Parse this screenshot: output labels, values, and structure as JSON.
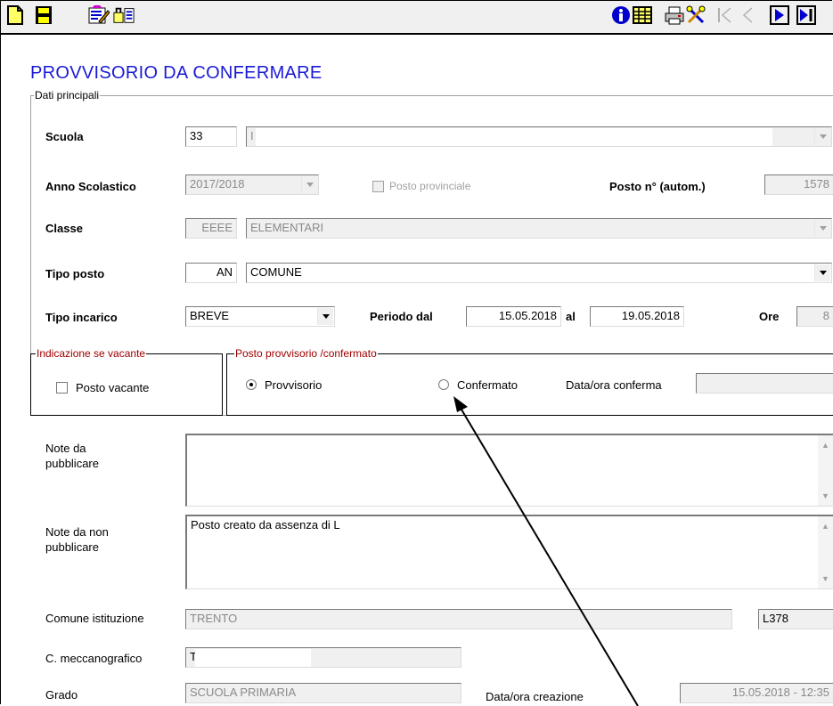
{
  "toolbar": {
    "icons": [
      "new-document-icon",
      "save-disk-icon",
      "edit-form-icon",
      "transfer-icon",
      "info-icon",
      "table-grid-icon",
      "print-icon",
      "tools-icon",
      "first-record-icon",
      "previous-record-icon",
      "next-record-icon",
      "last-record-icon"
    ]
  },
  "page_title": "PROVVISORIO DA CONFERMARE",
  "groups": {
    "dati_principali": "Dati principali",
    "vacante": "Indicazione se vacante",
    "provvisorio": "Posto provvisorio /confermato"
  },
  "fields": {
    "scuola": {
      "label": "Scuola",
      "code": "33",
      "name": "I"
    },
    "anno": {
      "label": "Anno Scolastico",
      "value": "2017/2018"
    },
    "posto_provinciale": {
      "label": "Posto provinciale",
      "checked": false
    },
    "posto_n": {
      "label": "Posto n° (autom.)",
      "value": "1578"
    },
    "classe": {
      "label": "Classe",
      "code": "EEEE",
      "name": "ELEMENTARI"
    },
    "tipo_posto": {
      "label": "Tipo posto",
      "code": "AN",
      "name": "COMUNE"
    },
    "tipo_incarico": {
      "label": "Tipo incarico",
      "value": "BREVE"
    },
    "periodo": {
      "label_dal": "Periodo dal",
      "dal": "15.05.2018",
      "label_al": "al",
      "al": "19.05.2018"
    },
    "ore": {
      "label": "Ore",
      "value": "8"
    },
    "posto_vacante": {
      "label": "Posto vacante",
      "checked": false
    },
    "radio_provvisorio": {
      "label": "Provvisorio",
      "selected": true
    },
    "radio_confermato": {
      "label": "Confermato",
      "selected": false
    },
    "data_conferma": {
      "label": "Data/ora conferma",
      "value": ""
    },
    "note_pubblicare": {
      "label_1": "Note da",
      "label_2": "pubblicare",
      "value": ""
    },
    "note_non_pubblicare": {
      "label_1": "Note da non",
      "label_2": "pubblicare",
      "value": "Posto creato da assenza di L"
    },
    "comune": {
      "label": "Comune istituzione",
      "value": "TRENTO",
      "code": "L378"
    },
    "meccanografico": {
      "label": "C. meccanografico",
      "value": "T"
    },
    "grado": {
      "label": "Grado",
      "value": "SCUOLA PRIMARIA"
    },
    "creazione": {
      "label": "Data/ora creazione",
      "value": "15.05.2018  -  12:35"
    }
  }
}
